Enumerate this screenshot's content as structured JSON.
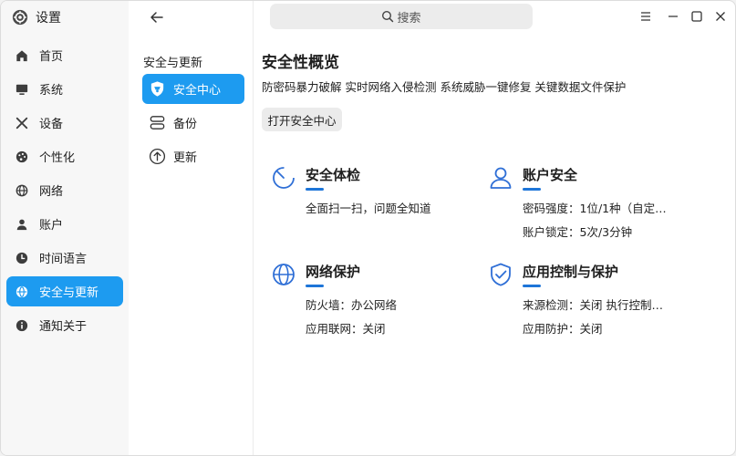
{
  "app": {
    "title": "设置",
    "logo_icon": "gear-icon"
  },
  "colors": {
    "accent": "#1d9bf0",
    "card_icon": "#2f6fd6",
    "underline": "#1d75d8"
  },
  "sidebar": {
    "items": [
      {
        "label": "首页",
        "icon": "home-icon",
        "active": false
      },
      {
        "label": "系统",
        "icon": "monitor-icon",
        "active": false
      },
      {
        "label": "设备",
        "icon": "tools-icon",
        "active": false
      },
      {
        "label": "个性化",
        "icon": "palette-icon",
        "active": false
      },
      {
        "label": "网络",
        "icon": "globe-icon",
        "active": false
      },
      {
        "label": "账户",
        "icon": "user-icon",
        "active": false
      },
      {
        "label": "时间语言",
        "icon": "clock-icon",
        "active": false
      },
      {
        "label": "安全与更新",
        "icon": "globe-icon",
        "active": true
      },
      {
        "label": "通知关于",
        "icon": "info-icon",
        "active": false
      }
    ]
  },
  "subnav": {
    "title": "安全与更新",
    "items": [
      {
        "label": "安全中心",
        "icon": "shield-icon",
        "active": true
      },
      {
        "label": "备份",
        "icon": "backup-icon",
        "active": false
      },
      {
        "label": "更新",
        "icon": "arrow-up-circle-icon",
        "active": false
      }
    ]
  },
  "search": {
    "placeholder": "搜索"
  },
  "main": {
    "title": "安全性概览",
    "description": "防密码暴力破解 实时网络入侵检测 系统威胁一键修复 关键数据文件保护",
    "open_button": "打开安全中心",
    "cards": [
      {
        "title": "安全体检",
        "icon": "scan-icon",
        "lines": [
          "全面扫一扫，问题全知道"
        ]
      },
      {
        "title": "账户安全",
        "icon": "user-outline-icon",
        "lines": [
          "密码强度：1位/1种（自定…",
          "账户锁定：5次/3分钟"
        ]
      },
      {
        "title": "网络保护",
        "icon": "globe-outline-icon",
        "lines": [
          "防火墙：办公网络",
          "应用联网：关闭"
        ]
      },
      {
        "title": "应用控制与保护",
        "icon": "shield-check-icon",
        "lines": [
          "来源检测：关闭   执行控制…",
          "应用防护：关闭"
        ]
      }
    ]
  }
}
